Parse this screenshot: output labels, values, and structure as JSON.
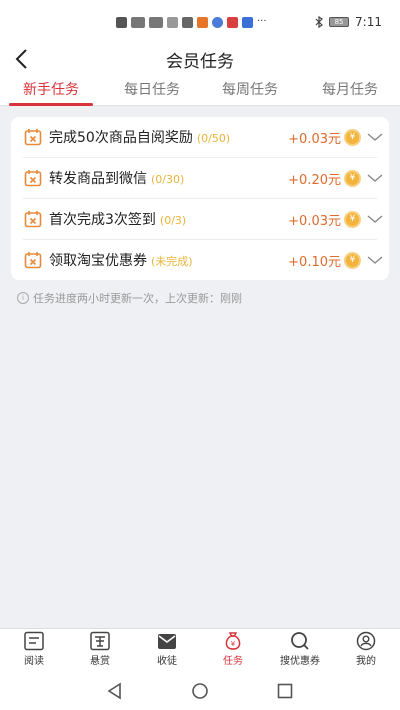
{
  "status": {
    "time": "7:11",
    "battery": "85"
  },
  "header": {
    "title": "会员任务"
  },
  "tabs": [
    {
      "label": "新手任务"
    },
    {
      "label": "每日任务"
    },
    {
      "label": "每周任务"
    },
    {
      "label": "每月任务"
    }
  ],
  "tasks": [
    {
      "name": "完成50次商品自阅奖励",
      "progress": "(0/50)",
      "reward": "+0.03元"
    },
    {
      "name": "转发商品到微信",
      "progress": "(0/30)",
      "reward": "+0.20元"
    },
    {
      "name": "首次完成3次签到",
      "progress": "(0/3)",
      "reward": "+0.03元"
    },
    {
      "name": "领取淘宝优惠券",
      "progress": "(未完成)",
      "reward": "+0.10元"
    }
  ],
  "coin_symbol": "¥",
  "note": {
    "text": "任务进度两小时更新一次，上次更新：刚刚"
  },
  "bottom_nav": [
    {
      "label": "阅读"
    },
    {
      "label": "悬赏"
    },
    {
      "label": "收徒"
    },
    {
      "label": "任务"
    },
    {
      "label": "搜优惠券"
    },
    {
      "label": "我的"
    }
  ],
  "colors": {
    "accent": "#d8333a",
    "reward": "#e06a2c",
    "progress": "#e8b53a",
    "coin": "#f3b33d"
  }
}
